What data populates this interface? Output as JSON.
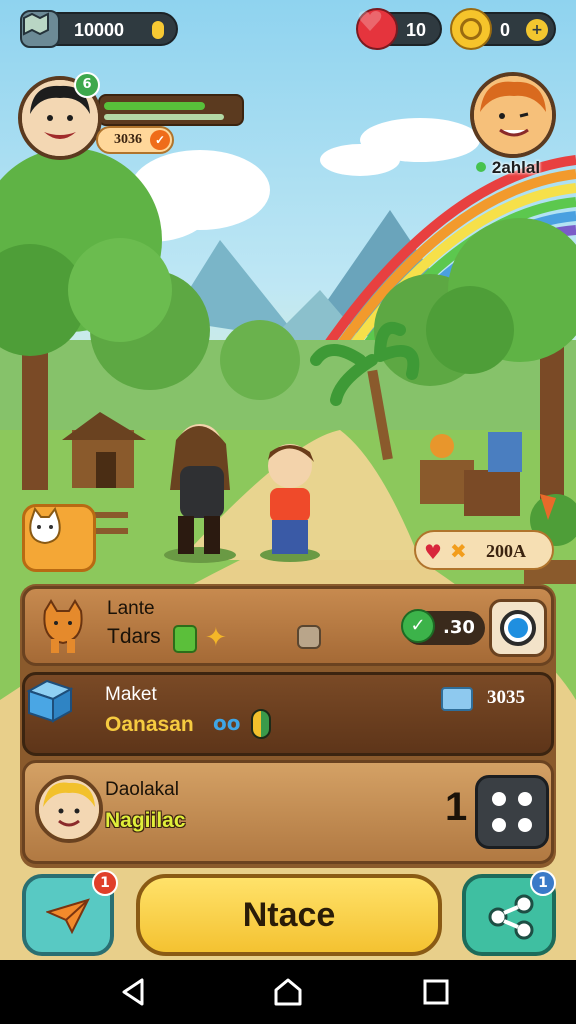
{
  "hud": {
    "coins": "10000",
    "hearts": "10",
    "gold": "0",
    "gold_plus": "+"
  },
  "player": {
    "level": "6",
    "xp_fraction": 0.75,
    "xp_label": "3036"
  },
  "friend": {
    "name": "2ahlal"
  },
  "score": {
    "value": "200A"
  },
  "panels": [
    {
      "title": "Lante",
      "subtitle": "Tdars",
      "badge_value": ".30"
    },
    {
      "title": "Maket",
      "subtitle": "Oanasan",
      "icon_text": "oo",
      "value": "3035"
    },
    {
      "title": "Daolakal",
      "subtitle": "Nagiilac",
      "count": "1"
    }
  ],
  "bottom": {
    "play_label": "Ntace",
    "mail_badge": "1",
    "share_badge": "1"
  },
  "colors": {
    "play_button": "#f4c231",
    "panel_brown": "#a56a36",
    "heart_red": "#e5343d",
    "coin_gold": "#f6c42b"
  }
}
